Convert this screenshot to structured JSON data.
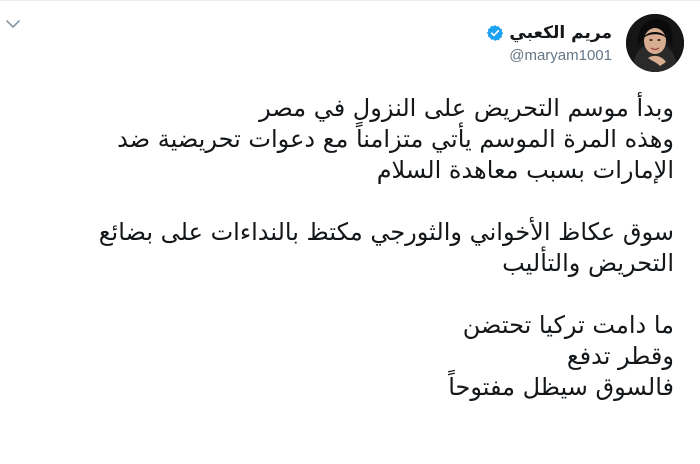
{
  "tweet": {
    "display_name": "مريم الكعبي",
    "handle": "@maryam1001",
    "verified": true,
    "icons": {
      "menu": "chevron-down-icon",
      "verified": "verified-badge-icon"
    },
    "colors": {
      "verified": "#1da1f2",
      "text": "#14171a",
      "handle": "#657786"
    },
    "paragraphs": [
      {
        "lines": [
          "وبدأ موسم التحريض على النزول في مصر",
          "وهذه المرة الموسم يأتي متزامناً مع دعوات تحريضية ضد",
          "الإمارات بسبب معاهدة السلام"
        ]
      },
      {
        "lines": [
          "سوق عكاظ الأخواني والثورجي مكتظ بالنداءات على بضائع",
          "التحريض والتأليب"
        ]
      },
      {
        "lines": [
          "ما دامت تركيا تحتضن",
          "وقطر تدفع",
          "فالسوق سيظل مفتوحاً"
        ]
      }
    ]
  }
}
